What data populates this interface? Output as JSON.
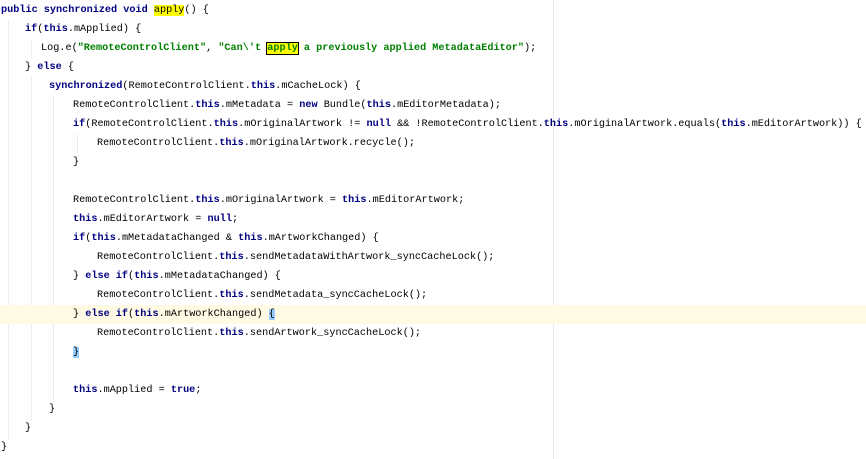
{
  "editor": {
    "caret_line": 16,
    "colors": {
      "keyword": "#000080",
      "string": "#008000",
      "search_highlight": "#ffff00",
      "caret_row": "#fffae3",
      "brace_match": "#99ccff"
    },
    "lines": [
      {
        "indent": 0,
        "tokens": [
          {
            "t": "public synchronized void ",
            "c": "kw"
          },
          {
            "t": "apply",
            "c": "hl"
          },
          {
            "t": "() {"
          }
        ]
      },
      {
        "indent": 1,
        "tokens": [
          {
            "t": "if",
            "c": "kw"
          },
          {
            "t": "("
          },
          {
            "t": "this",
            "c": "kw"
          },
          {
            "t": ".mApplied) {"
          }
        ]
      },
      {
        "indent": 2,
        "tokens": [
          {
            "t": "Log.e("
          },
          {
            "t": "\"RemoteControlClient\"",
            "c": "str"
          },
          {
            "t": ", "
          },
          {
            "t": "\"Can\\'t ",
            "c": "str"
          },
          {
            "t": "apply",
            "c": "str hlbox"
          },
          {
            "t": " a previously applied MetadataEditor\"",
            "c": "str"
          },
          {
            "t": ");"
          }
        ]
      },
      {
        "indent": 1,
        "tokens": [
          {
            "t": "} "
          },
          {
            "t": "else",
            "c": "kw"
          },
          {
            "t": " {"
          }
        ]
      },
      {
        "indent": 3,
        "tokens": [
          {
            "t": "synchronized",
            "c": "kw"
          },
          {
            "t": "(RemoteControlClient."
          },
          {
            "t": "this",
            "c": "kw"
          },
          {
            "t": ".mCacheLock) {"
          }
        ]
      },
      {
        "indent": 4,
        "tokens": [
          {
            "t": "RemoteControlClient."
          },
          {
            "t": "this",
            "c": "kw"
          },
          {
            "t": ".mMetadata = "
          },
          {
            "t": "new",
            "c": "kw"
          },
          {
            "t": " Bundle("
          },
          {
            "t": "this",
            "c": "kw"
          },
          {
            "t": ".mEditorMetadata);"
          }
        ]
      },
      {
        "indent": 4,
        "tokens": [
          {
            "t": "if",
            "c": "kw"
          },
          {
            "t": "(RemoteControlClient."
          },
          {
            "t": "this",
            "c": "kw"
          },
          {
            "t": ".mOriginalArtwork != "
          },
          {
            "t": "null",
            "c": "kw"
          },
          {
            "t": " && !RemoteControlClient."
          },
          {
            "t": "this",
            "c": "kw"
          },
          {
            "t": ".mOriginalArtwork.equals("
          },
          {
            "t": "this",
            "c": "kw"
          },
          {
            "t": ".mEditorArtwork)) {"
          }
        ]
      },
      {
        "indent": 5,
        "tokens": [
          {
            "t": "RemoteControlClient."
          },
          {
            "t": "this",
            "c": "kw"
          },
          {
            "t": ".mOriginalArtwork.recycle();"
          }
        ]
      },
      {
        "indent": 4,
        "tokens": [
          {
            "t": "}"
          }
        ]
      },
      {
        "indent": 4,
        "tokens": []
      },
      {
        "indent": 4,
        "tokens": [
          {
            "t": "RemoteControlClient."
          },
          {
            "t": "this",
            "c": "kw"
          },
          {
            "t": ".mOriginalArtwork = "
          },
          {
            "t": "this",
            "c": "kw"
          },
          {
            "t": ".mEditorArtwork;"
          }
        ]
      },
      {
        "indent": 4,
        "tokens": [
          {
            "t": "this",
            "c": "kw"
          },
          {
            "t": ".mEditorArtwork = "
          },
          {
            "t": "null",
            "c": "kw"
          },
          {
            "t": ";"
          }
        ]
      },
      {
        "indent": 4,
        "tokens": [
          {
            "t": "if",
            "c": "kw"
          },
          {
            "t": "("
          },
          {
            "t": "this",
            "c": "kw"
          },
          {
            "t": ".mMetadataChanged & "
          },
          {
            "t": "this",
            "c": "kw"
          },
          {
            "t": ".mArtworkChanged) {"
          }
        ]
      },
      {
        "indent": 5,
        "tokens": [
          {
            "t": "RemoteControlClient."
          },
          {
            "t": "this",
            "c": "kw"
          },
          {
            "t": ".sendMetadataWithArtwork_syncCacheLock();"
          }
        ]
      },
      {
        "indent": 4,
        "tokens": [
          {
            "t": "} "
          },
          {
            "t": "else if",
            "c": "kw"
          },
          {
            "t": "("
          },
          {
            "t": "this",
            "c": "kw"
          },
          {
            "t": ".mMetadataChanged) {"
          }
        ]
      },
      {
        "indent": 5,
        "tokens": [
          {
            "t": "RemoteControlClient."
          },
          {
            "t": "this",
            "c": "kw"
          },
          {
            "t": ".sendMetadata_syncCacheLock();"
          }
        ]
      },
      {
        "indent": 4,
        "tokens": [
          {
            "t": "} "
          },
          {
            "t": "else if",
            "c": "kw"
          },
          {
            "t": "("
          },
          {
            "t": "this",
            "c": "kw"
          },
          {
            "t": ".mArtworkChanged) "
          },
          {
            "t": "{",
            "c": "brace"
          }
        ]
      },
      {
        "indent": 5,
        "tokens": [
          {
            "t": "RemoteControlClient."
          },
          {
            "t": "this",
            "c": "kw"
          },
          {
            "t": ".sendArtwork_syncCacheLock();"
          }
        ]
      },
      {
        "indent": 4,
        "tokens": [
          {
            "t": "}",
            "c": "brace"
          }
        ]
      },
      {
        "indent": 4,
        "tokens": []
      },
      {
        "indent": 4,
        "tokens": [
          {
            "t": "this",
            "c": "kw"
          },
          {
            "t": ".mApplied = "
          },
          {
            "t": "true",
            "c": "kw"
          },
          {
            "t": ";"
          }
        ]
      },
      {
        "indent": 3,
        "tokens": [
          {
            "t": "}"
          }
        ]
      },
      {
        "indent": 1,
        "tokens": [
          {
            "t": "}"
          }
        ]
      },
      {
        "indent": 0,
        "tokens": [
          {
            "t": "}"
          }
        ]
      }
    ]
  }
}
